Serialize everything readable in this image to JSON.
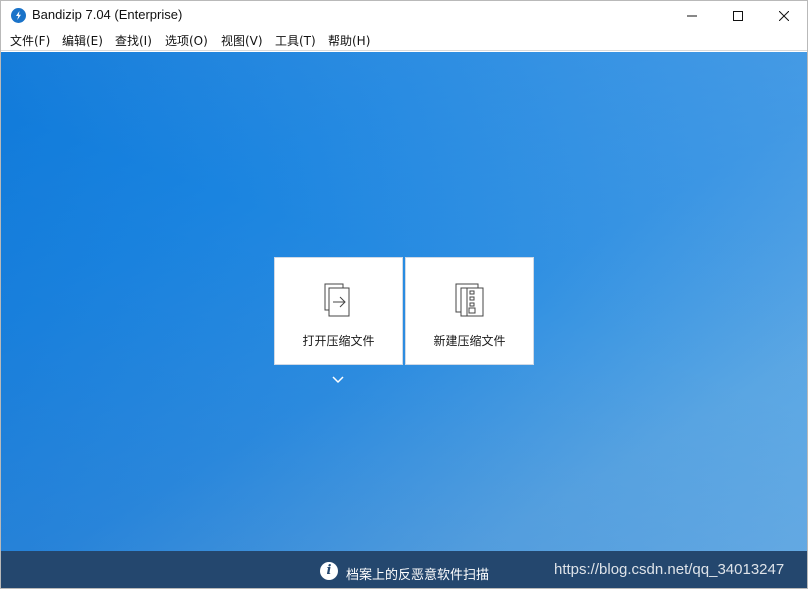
{
  "window": {
    "title": "Bandizip 7.04 (Enterprise)",
    "icon": "bandizip-logo-icon"
  },
  "menubar": {
    "items": [
      {
        "label": "文件(F)"
      },
      {
        "label": "编辑(E)"
      },
      {
        "label": "查找(I)"
      },
      {
        "label": "选项(O)"
      },
      {
        "label": "视图(V)"
      },
      {
        "label": "工具(T)"
      },
      {
        "label": "帮助(H)"
      }
    ]
  },
  "actions": {
    "open_archive": {
      "label": "打开压缩文件",
      "icon": "open-file-icon"
    },
    "new_archive": {
      "label": "新建压缩文件",
      "icon": "zip-file-icon"
    }
  },
  "statusbar": {
    "text": "档案上的反恶意软件扫描",
    "icon": "info-icon"
  },
  "watermark": "https://blog.csdn.net/qq_34013247",
  "colors": {
    "main_bg_start": "#0f79d9",
    "main_bg_end": "#68aee6",
    "statusbar_bg": "#24476e",
    "accent": "#1a73c9"
  }
}
